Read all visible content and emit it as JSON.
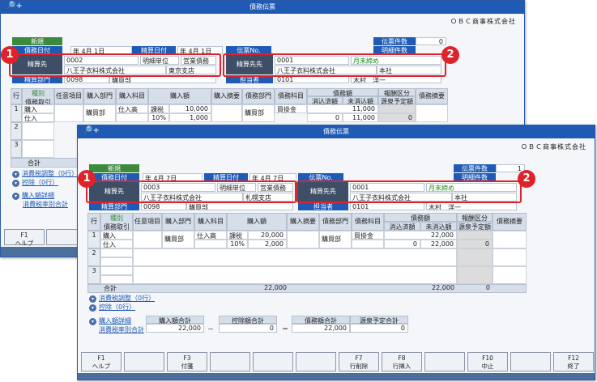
{
  "window_title": "債務伝票",
  "title_icon": "🔎+",
  "company": "ＯＢＣ商事株式会社",
  "back": {
    "new_badge": "新規",
    "date_label": "債務日付",
    "date_value": "年  4月  1日",
    "date2_label": "精算日付",
    "date2_value": "年  4月  1日",
    "slip_label": "伝票No.",
    "count_label": "伝票件数",
    "count_value": "0",
    "detail_count_label": "明細件数",
    "payee_label": "精算先",
    "payee_code": "0002",
    "payee_name": "八王子衣料株式会社",
    "unit_label": "明細単位",
    "category": "営業債務",
    "branch": "東京支店",
    "dest_label": "精算先先",
    "dest_code": "0001",
    "dest_name": "八王子衣料株式会社",
    "dest_close": "月末締め",
    "dest_branch": "本社",
    "dept_label": "精算部門",
    "dept_code": "0098",
    "dept_name": "購買部",
    "staff_label": "担当者",
    "staff_code": "0101",
    "staff_name": "木村　洋一",
    "row_label": "行",
    "col_kind_top": "種別",
    "col_kind_bottom": "債務取引",
    "col_item": "任意項目",
    "col_dept": "購入部門",
    "col_subject": "購入科目",
    "col_amount": "購入額",
    "col_memo": "購入摘要",
    "col_debt_dept": "債務部門",
    "col_debt_subject": "債務科目",
    "col_debt_amount": "債務額",
    "col_reduce": "消込済額",
    "col_unreduce": "未消込額",
    "col_report": "報酬区分",
    "col_pay": "源泉予定額",
    "col_debt_memo": "債務摘要",
    "r1_kind_a": "購入",
    "r1_kind_b": "仕入",
    "r1_dept": "購買部",
    "r1_subject": "仕入高",
    "r1_tax": "課税",
    "r1_rate": "10%",
    "r1_amount": "10,000",
    "r1_tax_amount": "1,000",
    "r1_debt_subject": "買掛金",
    "r1_debt_amount": "11,000",
    "r1_reduce": "0",
    "r1_unreduce": "11,000",
    "r1_pay": "0",
    "total_label": "合計",
    "tax_adjust": "消費税調整（0行）",
    "deduct": "控除（0行）",
    "purchase_detail": "購入額詳細",
    "tax_rate_total": "消費税率別合計",
    "f1_key": "F1",
    "f1_label": "ヘルプ"
  },
  "front": {
    "new_badge": "新規",
    "date_label": "債務日付",
    "date_value": "年  4月  7日",
    "date2_label": "精算日付",
    "date2_value": "年  4月  7日",
    "slip_label": "伝票No.",
    "count_label": "伝票件数",
    "count_value": "1",
    "detail_count_label": "明細件数",
    "payee_label": "精算先",
    "payee_code": "0003",
    "payee_name": "八王子衣料株式会社",
    "unit_label": "明細単位",
    "category": "営業債務",
    "branch": "札幌支店",
    "dest_label": "精算先先",
    "dest_code": "0001",
    "dest_name": "八王子衣料株式会社",
    "dest_close": "月末締め",
    "dest_branch": "本社",
    "dept_label": "精算部門",
    "dept_code": "0098",
    "dept_name": "購買部",
    "staff_label": "担当者",
    "staff_code": "0101",
    "staff_name": "木村　洋一",
    "row_label": "行",
    "col_kind_top": "種別",
    "col_kind_bottom": "債務取引",
    "col_item": "任意項目",
    "col_dept": "購入部門",
    "col_subject": "購入科目",
    "col_amount": "購入額",
    "col_memo": "購入摘要",
    "col_debt_dept": "債務部門",
    "col_debt_subject": "債務科目",
    "col_debt_amount": "債務額",
    "col_reduce": "消込済額",
    "col_unreduce": "未消込額",
    "col_report": "報酬区分",
    "col_pay": "源泉予定額",
    "col_debt_memo": "債務摘要",
    "r1_kind_a": "購入",
    "r1_kind_b": "仕入",
    "r1_dept": "購買部",
    "r1_subject": "仕入高",
    "r1_tax": "課税",
    "r1_rate": "10%",
    "r1_amount": "20,000",
    "r1_tax_amount": "2,000",
    "r1_debt_subject": "買掛金",
    "r1_debt_amount": "22,000",
    "r1_reduce": "0",
    "r1_unreduce": "22,000",
    "r1_pay": "0",
    "total_label": "合計",
    "total_amount": "22,000",
    "total_unreduce": "22,000",
    "total_pay": "0",
    "tax_adjust": "消費税調整（0行）",
    "deduct": "控除（0行）",
    "purchase_detail": "購入額詳細",
    "tax_rate_total": "消費税率別合計",
    "sum_purchase_label": "購入額合計",
    "sum_purchase": "22,000",
    "minus": "－",
    "sum_deduct_label": "控除額合計",
    "sum_deduct": "0",
    "equals": "＝",
    "sum_debt_label": "債務額合計",
    "sum_debt": "22,000",
    "sum_pay_label": "源泉予定合計",
    "sum_pay": "0"
  },
  "fkeys": [
    {
      "key": "F1",
      "label": "ヘルプ"
    },
    {
      "key": "",
      "label": ""
    },
    {
      "key": "F3",
      "label": "付箋"
    },
    {
      "key": "",
      "label": ""
    },
    {
      "key": "",
      "label": ""
    },
    {
      "key": "",
      "label": ""
    },
    {
      "key": "F7",
      "label": "行削除"
    },
    {
      "key": "F8",
      "label": "行挿入"
    },
    {
      "key": "",
      "label": ""
    },
    {
      "key": "F10",
      "label": "中止"
    },
    {
      "key": "",
      "label": ""
    },
    {
      "key": "F12",
      "label": "終了"
    }
  ],
  "markers": [
    "1",
    "2"
  ],
  "colors": {
    "title_bar": "#1f5ab4",
    "highlight": "#e0222a",
    "new_badge": "#3c8a3c"
  }
}
